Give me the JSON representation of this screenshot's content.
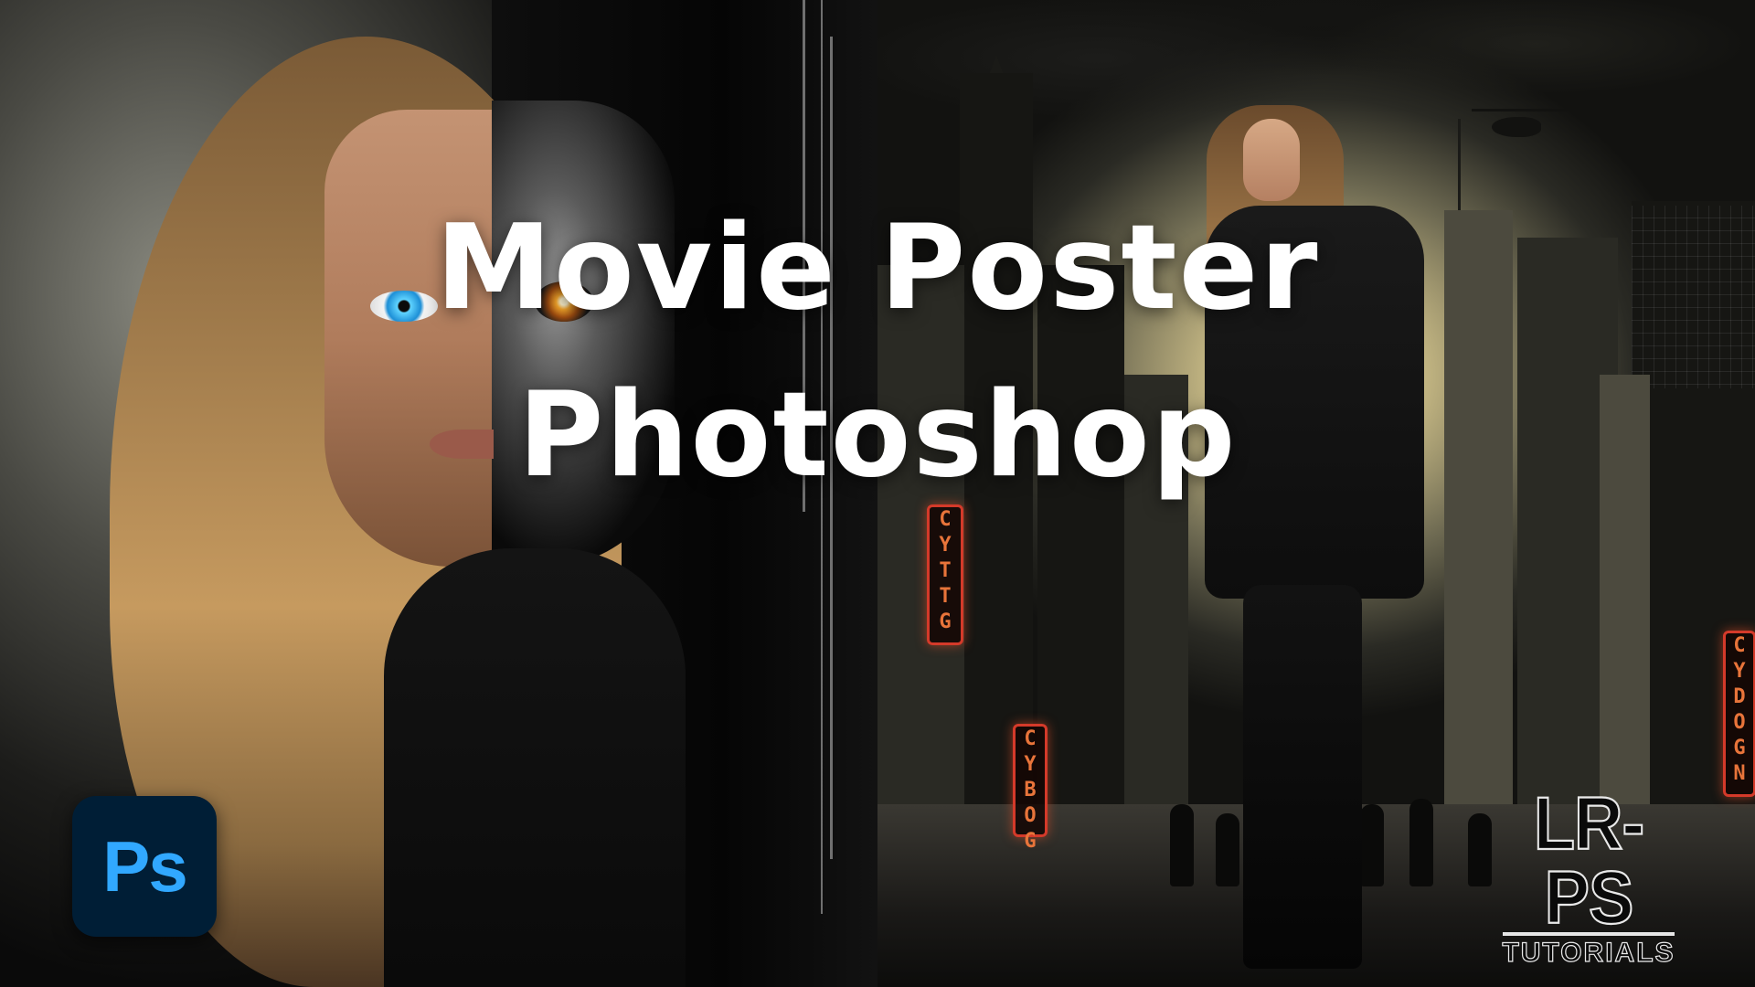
{
  "title": {
    "line1": "Movie Poster",
    "line2": "Photoshop"
  },
  "app_badge": {
    "label": "Ps",
    "icon": "photoshop-icon",
    "background": "#001e36",
    "foreground": "#31a8ff"
  },
  "brand": {
    "name": "LR-PS",
    "subtitle": "TUTORIALS"
  },
  "neon_signs": [
    "CYTTG",
    "CYBOG",
    "CYDOGN"
  ],
  "colors": {
    "title_text": "#ffffff",
    "neon_red": "#d43a2a",
    "cyborg_eye": "#f0a22a",
    "human_eye": "#1d8fd6"
  }
}
